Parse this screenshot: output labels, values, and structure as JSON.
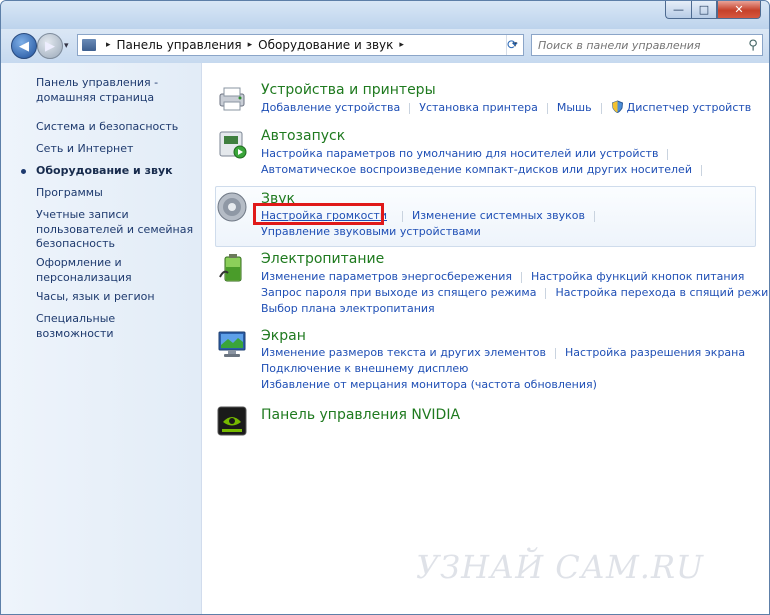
{
  "window": {
    "min_label": "—",
    "max_label": "□",
    "close_label": "✕"
  },
  "nav": {
    "back_label": "◀",
    "forward_label": "▶",
    "history_label": "▾",
    "breadcrumb": [
      "Панель управления",
      "Оборудование и звук"
    ],
    "crumb_sep": "▸",
    "refresh_label": "⟳",
    "address_drop_label": "▾"
  },
  "search": {
    "placeholder": "Поиск в панели управления",
    "icon": "⚲"
  },
  "sidebar": {
    "items": [
      {
        "label": "Панель управления - домашняя страница"
      },
      {
        "label": "Система и безопасность"
      },
      {
        "label": "Сеть и Интернет"
      },
      {
        "label": "Оборудование и звук"
      },
      {
        "label": "Программы"
      },
      {
        "label": "Учетные записи пользователей и семейная безопасность"
      },
      {
        "label": "Оформление и персонализация"
      },
      {
        "label": "Часы, язык и регион"
      },
      {
        "label": "Специальные возможности"
      }
    ]
  },
  "categories": {
    "devices": {
      "title": "Устройства и принтеры",
      "links": [
        "Добавление устройства",
        "Установка принтера",
        "Мышь",
        "Диспетчер устройств"
      ]
    },
    "autoplay": {
      "title": "Автозапуск",
      "links": [
        "Настройка параметров по умолчанию для носителей или устройств",
        "Автоматическое воспроизведение компакт-дисков или других носителей"
      ]
    },
    "sound": {
      "title": "Звук",
      "links": [
        "Настройка громкости",
        "Изменение системных звуков",
        "Управление звуковыми устройствами"
      ]
    },
    "power": {
      "title": "Электропитание",
      "links": [
        "Изменение параметров энергосбережения",
        "Настройка функций кнопок питания",
        "Запрос пароля при выходе из спящего режима",
        "Настройка перехода в спящий режим",
        "Выбор плана электропитания"
      ]
    },
    "display": {
      "title": "Экран",
      "links": [
        "Изменение размеров текста и других элементов",
        "Настройка разрешения экрана",
        "Подключение к внешнему дисплею",
        "Избавление от мерцания монитора (частота обновления)"
      ]
    },
    "nvidia": {
      "title": "Панель управления NVIDIA"
    }
  },
  "watermark": "УЗНАЙ САМ.RU",
  "colors": {
    "category_title": "#1f7a1f",
    "link": "#1f4fb5",
    "highlight_box": "#e01919"
  }
}
